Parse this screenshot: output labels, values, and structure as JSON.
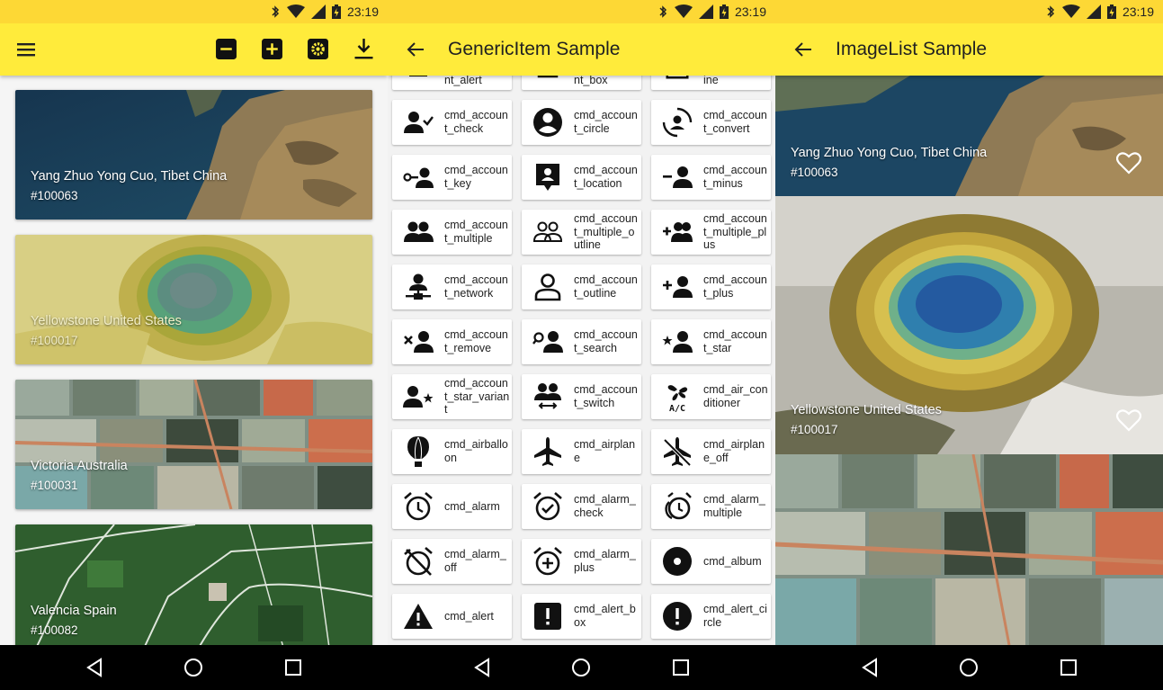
{
  "status": {
    "time": "23:19"
  },
  "screen1": {
    "cards": [
      {
        "title": "Yang Zhuo Yong Cuo, Tibet China",
        "id": "#100063"
      },
      {
        "title": "Yellowstone United States",
        "id": "#100017"
      },
      {
        "title": "Victoria Australia",
        "id": "#100031"
      },
      {
        "title": "Valencia Spain",
        "id": "#100082"
      }
    ]
  },
  "screen2": {
    "title": "GenericItem Sample",
    "partial_row": [
      "nt_alert",
      "nt_box",
      "ine"
    ],
    "items": [
      {
        "label": "cmd_account_check",
        "icon": "account-check-icon"
      },
      {
        "label": "cmd_account_circle",
        "icon": "account-circle-icon"
      },
      {
        "label": "cmd_account_convert",
        "icon": "account-convert-icon"
      },
      {
        "label": "cmd_account_key",
        "icon": "account-key-icon"
      },
      {
        "label": "cmd_account_location",
        "icon": "account-location-icon"
      },
      {
        "label": "cmd_account_minus",
        "icon": "account-minus-icon"
      },
      {
        "label": "cmd_account_multiple",
        "icon": "account-multiple-icon"
      },
      {
        "label": "cmd_account_multiple_outline",
        "icon": "account-multiple-outline-icon"
      },
      {
        "label": "cmd_account_multiple_plus",
        "icon": "account-multiple-plus-icon"
      },
      {
        "label": "cmd_account_network",
        "icon": "account-network-icon"
      },
      {
        "label": "cmd_account_outline",
        "icon": "account-outline-icon"
      },
      {
        "label": "cmd_account_plus",
        "icon": "account-plus-icon"
      },
      {
        "label": "cmd_account_remove",
        "icon": "account-remove-icon"
      },
      {
        "label": "cmd_account_search",
        "icon": "account-search-icon"
      },
      {
        "label": "cmd_account_star",
        "icon": "account-star-icon"
      },
      {
        "label": "cmd_account_star_variant",
        "icon": "account-star-variant-icon"
      },
      {
        "label": "cmd_account_switch",
        "icon": "account-switch-icon"
      },
      {
        "label": "cmd_air_conditioner",
        "icon": "air-conditioner-icon"
      },
      {
        "label": "cmd_airballoon",
        "icon": "airballoon-icon"
      },
      {
        "label": "cmd_airplane",
        "icon": "airplane-icon"
      },
      {
        "label": "cmd_airplane_off",
        "icon": "airplane-off-icon"
      },
      {
        "label": "cmd_alarm",
        "icon": "alarm-icon"
      },
      {
        "label": "cmd_alarm_check",
        "icon": "alarm-check-icon"
      },
      {
        "label": "cmd_alarm_multiple",
        "icon": "alarm-multiple-icon"
      },
      {
        "label": "cmd_alarm_off",
        "icon": "alarm-off-icon"
      },
      {
        "label": "cmd_alarm_plus",
        "icon": "alarm-plus-icon"
      },
      {
        "label": "cmd_album",
        "icon": "album-icon"
      },
      {
        "label": "cmd_alert",
        "icon": "alert-icon"
      },
      {
        "label": "cmd_alert_box",
        "icon": "alert-box-icon"
      },
      {
        "label": "cmd_alert_circle",
        "icon": "alert-circle-icon"
      }
    ]
  },
  "screen3": {
    "title": "ImageList Sample",
    "items": [
      {
        "title": "Yang Zhuo Yong Cuo, Tibet China",
        "id": "#100063"
      },
      {
        "title": "Yellowstone United States",
        "id": "#100017"
      }
    ]
  },
  "colors": {
    "statusbar": "#fdd835",
    "appbar": "#ffeb3b"
  }
}
